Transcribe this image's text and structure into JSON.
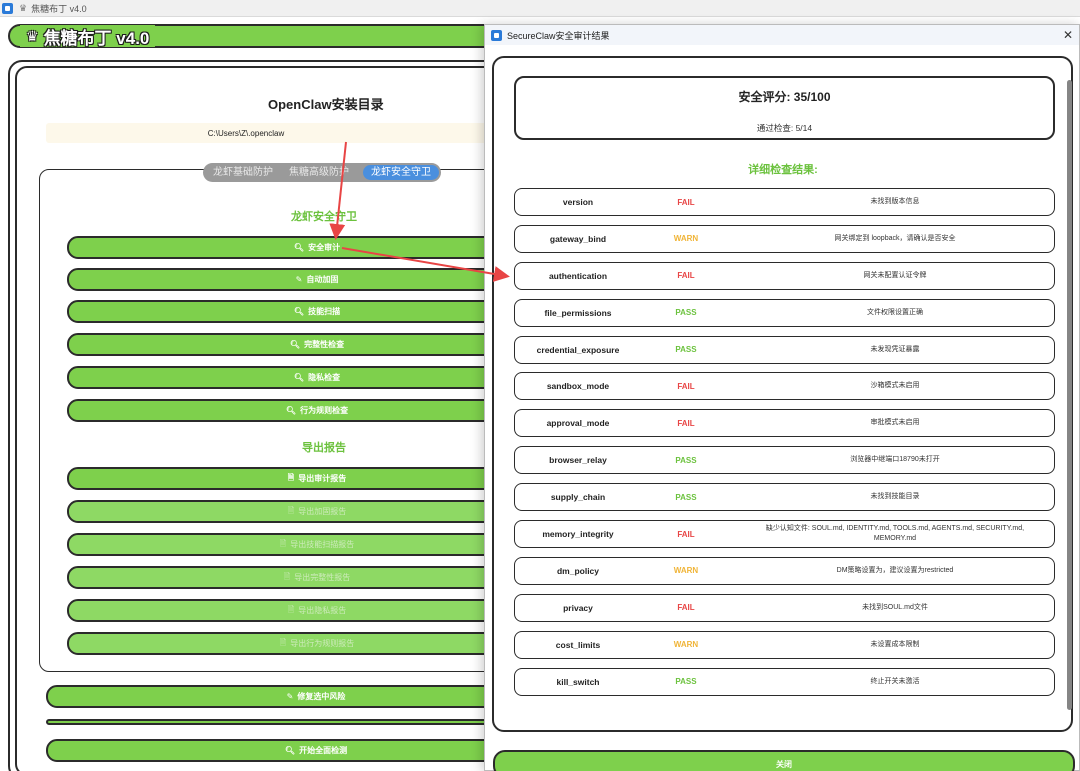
{
  "main_window": {
    "title": "焦糖布丁 v4.0",
    "brand": "焦糖布丁 v4.0",
    "panel_title": "OpenClaw安装目录",
    "path": "C:\\Users\\Z\\.openclaw",
    "tabs": [
      "龙虾基础防护",
      "焦糖高级防护",
      "龙虾安全守卫"
    ],
    "section_security": "龙虾安全守卫",
    "security_buttons": [
      {
        "label": "安全审计",
        "icon": "search-icon"
      },
      {
        "label": "自动加固",
        "icon": "wrench-icon"
      },
      {
        "label": "技能扫描",
        "icon": "search-icon"
      },
      {
        "label": "完整性检查",
        "icon": "search-icon"
      },
      {
        "label": "隐私检查",
        "icon": "search-icon"
      },
      {
        "label": "行为规则检查",
        "icon": "search-icon"
      }
    ],
    "section_export": "导出报告",
    "export_buttons": [
      {
        "label": "导出审计报告",
        "icon": "document-icon"
      },
      {
        "label": "导出加固报告",
        "icon": "document-icon"
      },
      {
        "label": "导出技能扫描报告",
        "icon": "document-icon"
      },
      {
        "label": "导出完整性报告",
        "icon": "document-icon"
      },
      {
        "label": "导出隐私报告",
        "icon": "document-icon"
      },
      {
        "label": "导出行为规则报告",
        "icon": "document-icon"
      }
    ],
    "fix_button": "修复选中风险",
    "start_button": "开始全面检测"
  },
  "dialog": {
    "title": "SecureClaw安全审计结果",
    "score_title": "安全评分: 35/100",
    "score_sub": "通过检查: 5/14",
    "details_heading": "详细检查结果:",
    "checks": [
      {
        "name": "version",
        "status": "FAIL",
        "desc": "未找到版本信息"
      },
      {
        "name": "gateway_bind",
        "status": "WARN",
        "desc": "网关绑定到 loopback，请确认是否安全"
      },
      {
        "name": "authentication",
        "status": "FAIL",
        "desc": "网关未配置认证令牌"
      },
      {
        "name": "file_permissions",
        "status": "PASS",
        "desc": "文件权限设置正确"
      },
      {
        "name": "credential_exposure",
        "status": "PASS",
        "desc": "未发现凭证暴露"
      },
      {
        "name": "sandbox_mode",
        "status": "FAIL",
        "desc": "沙箱模式未启用"
      },
      {
        "name": "approval_mode",
        "status": "FAIL",
        "desc": "审批模式未启用"
      },
      {
        "name": "browser_relay",
        "status": "PASS",
        "desc": "浏览器中继端口18790未打开"
      },
      {
        "name": "supply_chain",
        "status": "PASS",
        "desc": "未找到技能目录"
      },
      {
        "name": "memory_integrity",
        "status": "FAIL",
        "desc": "缺少认知文件: SOUL.md, IDENTITY.md, TOOLS.md, AGENTS.md, SECURITY.md, MEMORY.md"
      },
      {
        "name": "dm_policy",
        "status": "WARN",
        "desc": "DM策略设置为，建议设置为restricted"
      },
      {
        "name": "privacy",
        "status": "FAIL",
        "desc": "未找到SOUL.md文件"
      },
      {
        "name": "cost_limits",
        "status": "WARN",
        "desc": "未设置成本限制"
      },
      {
        "name": "kill_switch",
        "status": "PASS",
        "desc": "终止开关未激活"
      }
    ],
    "close_button": "关闭"
  },
  "colors": {
    "accent_green": "#7ed04c",
    "fail": "#e84545",
    "warn": "#f0b437",
    "pass": "#6cc23e",
    "active_tab": "#4a8fde",
    "annotation_arrow": "#e84545"
  }
}
